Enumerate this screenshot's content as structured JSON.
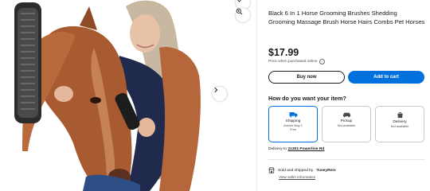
{
  "gallery": {
    "heart_icon": "heart-icon",
    "zoom_icon": "zoom-in-icon",
    "next_icon": "chevron-right-icon"
  },
  "product": {
    "title": "Black 6 In 1 Horse Grooming Brushes Shedding Grooming Massage Brush Horse Hairs Combs Pet Horses",
    "price": "$17.99",
    "price_note": "Price when purchased online"
  },
  "actions": {
    "buy_now": "Buy now",
    "add_to_cart": "Add to cart"
  },
  "fulfillment": {
    "question": "How do you want your item?",
    "options": [
      {
        "label": "Shipping",
        "sub1": "Arrives May 1",
        "sub2": "Free",
        "icon": "truck-icon"
      },
      {
        "label": "Pickup",
        "sub1": "Not available",
        "sub2": "",
        "icon": "car-icon"
      },
      {
        "label": "Delivery",
        "sub1": "Not available",
        "sub2": "",
        "icon": "delivery-bag-icon"
      }
    ],
    "delivery_prefix": "Delivery to",
    "delivery_address": "21301 Powerline Rd"
  },
  "seller": {
    "prefix": "Sold and shipped by",
    "name": "TuseyRein",
    "link": "View seller information"
  },
  "colors": {
    "accent": "#0071dc",
    "text": "#1b1b1b"
  }
}
